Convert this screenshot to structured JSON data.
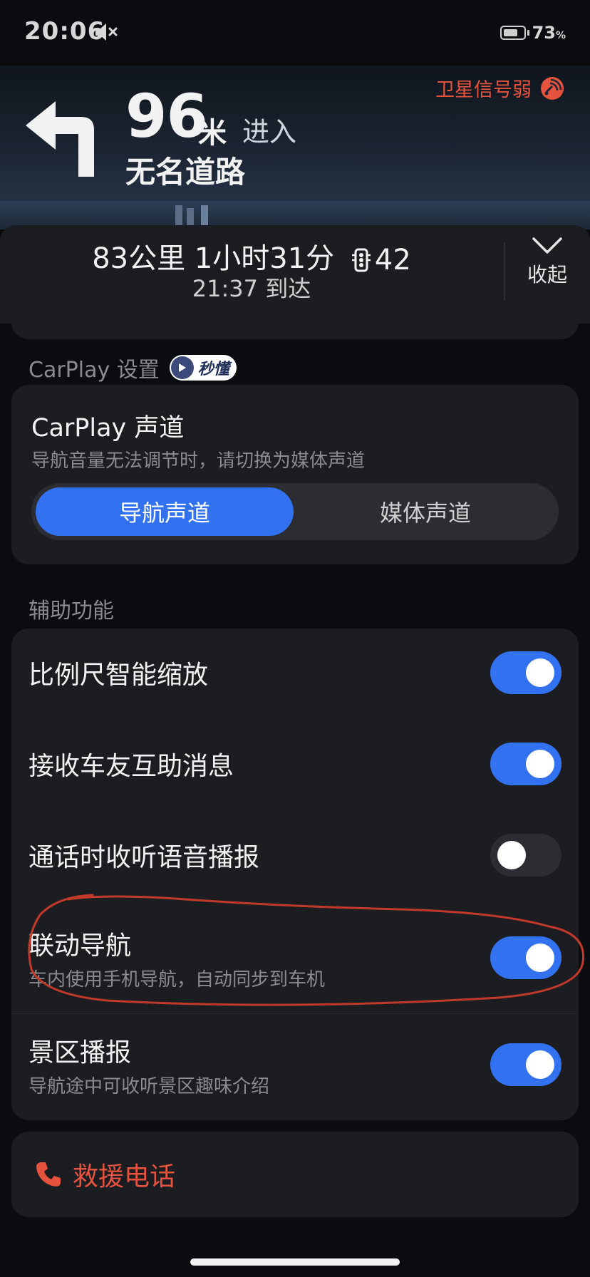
{
  "status_bar": {
    "time": "20:06",
    "battery_percent": "73",
    "battery_unit": "%",
    "battery_level": 0.73
  },
  "nav": {
    "satellite_warning": "卫星信号弱",
    "distance": "96",
    "unit": "米",
    "action": "进入",
    "road": "无名道路"
  },
  "trip": {
    "distance": "83公里",
    "duration": "1小时31分",
    "traffic_lights": "42",
    "eta": "21:37 到达",
    "collapse_label": "收起"
  },
  "carplay": {
    "section_title": "CarPlay 设置",
    "badge": "秒懂",
    "channel_title": "CarPlay 声道",
    "channel_desc": "导航音量无法调节时，请切换为媒体声道",
    "options": [
      "导航声道",
      "媒体声道"
    ],
    "selected": "导航声道"
  },
  "assist": {
    "section_title": "辅助功能",
    "items": [
      {
        "title": "比例尺智能缩放",
        "subtitle": "",
        "on": true
      },
      {
        "title": "接收车友互助消息",
        "subtitle": "",
        "on": true
      },
      {
        "title": "通话时收听语音播报",
        "subtitle": "",
        "on": false
      },
      {
        "title": "联动导航",
        "subtitle": "车内使用手机导航，自动同步到车机",
        "on": true
      },
      {
        "title": "景区播报",
        "subtitle": "导航途中可收听景区趣味介绍",
        "on": true
      }
    ]
  },
  "sos": {
    "label": "救援电话"
  },
  "colors": {
    "accent": "#3272f0",
    "warning": "#e5533f",
    "annotation": "#c0392b"
  }
}
